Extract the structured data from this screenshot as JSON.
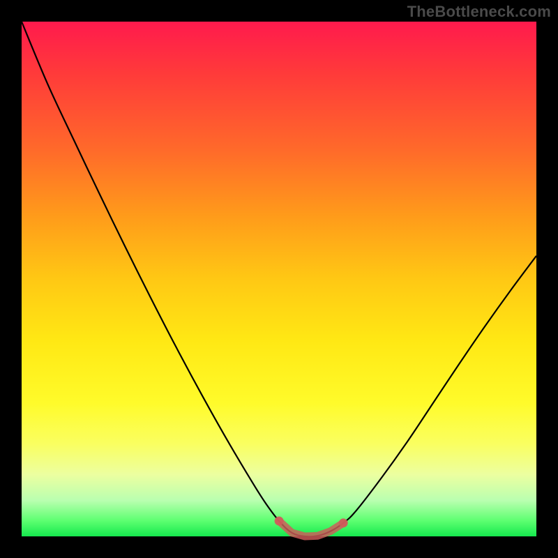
{
  "watermark": "TheBottleneck.com",
  "chart_data": {
    "type": "line",
    "x": [
      0.0,
      0.05,
      0.1,
      0.15,
      0.2,
      0.25,
      0.3,
      0.35,
      0.4,
      0.45,
      0.475,
      0.5,
      0.525,
      0.55,
      0.575,
      0.6,
      0.625,
      0.65,
      0.7,
      0.75,
      0.8,
      0.85,
      0.9,
      0.95,
      1.0
    ],
    "y": [
      1.0,
      0.88,
      0.773,
      0.668,
      0.565,
      0.465,
      0.368,
      0.275,
      0.186,
      0.102,
      0.063,
      0.03,
      0.007,
      0.0,
      0.001,
      0.01,
      0.026,
      0.05,
      0.115,
      0.185,
      0.26,
      0.335,
      0.408,
      0.478,
      0.545
    ],
    "highlight_x_range": [
      0.5,
      0.63
    ],
    "highlight_color": "#d15a5a",
    "xlim": [
      0,
      1
    ],
    "ylim": [
      0,
      1
    ],
    "title": "",
    "xlabel": "",
    "ylabel": ""
  },
  "colors": {
    "frame": "#000000",
    "curve": "#000000",
    "highlight": "#d15a5a"
  }
}
